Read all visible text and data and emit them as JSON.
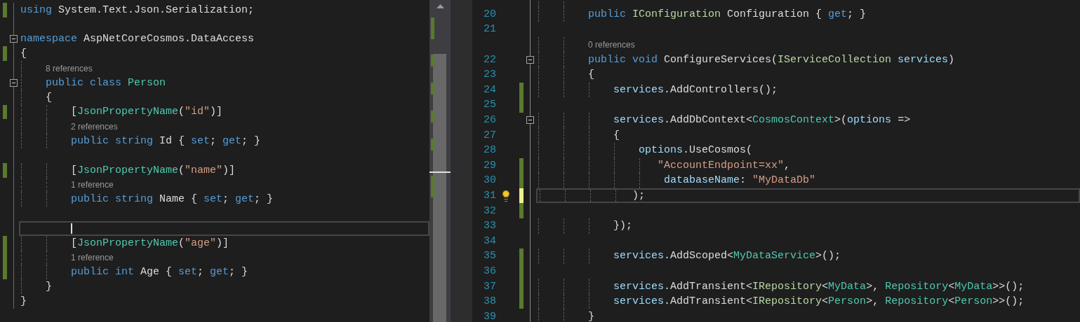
{
  "left_editor": {
    "lines": [
      {
        "kind": "code",
        "changed": true,
        "saved": true,
        "tokens": [
          {
            "text": "using",
            "kind": "keyword"
          },
          {
            "text": " System.Text.Json.Serialization;",
            "kind": "plain"
          }
        ]
      },
      {
        "kind": "blank"
      },
      {
        "kind": "code",
        "fold": true,
        "tokens": [
          {
            "text": "namespace",
            "kind": "keyword"
          },
          {
            "text": " AspNetCoreCosmos.DataAccess",
            "kind": "plain"
          }
        ]
      },
      {
        "kind": "code",
        "changed": true,
        "saved": true,
        "tokens": [
          {
            "text": "{",
            "kind": "plain"
          }
        ]
      },
      {
        "kind": "codelens",
        "text": "8 references"
      },
      {
        "kind": "code",
        "fold": true,
        "tokens": [
          {
            "text": "    public class",
            "kind": "keyword"
          },
          {
            "text": " Person",
            "kind": "type"
          }
        ]
      },
      {
        "kind": "code",
        "tokens": [
          {
            "text": "    {",
            "kind": "plain"
          }
        ]
      },
      {
        "kind": "code",
        "changed": true,
        "saved": true,
        "tokens": [
          {
            "text": "        [",
            "kind": "plain"
          },
          {
            "text": "JsonPropertyName",
            "kind": "type"
          },
          {
            "text": "(",
            "kind": "plain"
          },
          {
            "text": "\"id\"",
            "kind": "string"
          },
          {
            "text": ")]",
            "kind": "plain"
          }
        ]
      },
      {
        "kind": "codelens",
        "text": "2 references"
      },
      {
        "kind": "code",
        "tokens": [
          {
            "text": "        public string",
            "kind": "keyword"
          },
          {
            "text": " Id { ",
            "kind": "plain"
          },
          {
            "text": "set",
            "kind": "keyword"
          },
          {
            "text": "; ",
            "kind": "plain"
          },
          {
            "text": "get",
            "kind": "keyword"
          },
          {
            "text": "; }",
            "kind": "plain"
          }
        ]
      },
      {
        "kind": "blank"
      },
      {
        "kind": "code",
        "changed": true,
        "saved": true,
        "tokens": [
          {
            "text": "        [",
            "kind": "plain"
          },
          {
            "text": "JsonPropertyName",
            "kind": "type"
          },
          {
            "text": "(",
            "kind": "plain"
          },
          {
            "text": "\"name\"",
            "kind": "string"
          },
          {
            "text": ")]",
            "kind": "plain"
          }
        ]
      },
      {
        "kind": "codelens",
        "text": "1 reference"
      },
      {
        "kind": "code",
        "tokens": [
          {
            "text": "        public string",
            "kind": "keyword"
          },
          {
            "text": " Name { ",
            "kind": "plain"
          },
          {
            "text": "set",
            "kind": "keyword"
          },
          {
            "text": "; ",
            "kind": "plain"
          },
          {
            "text": "get",
            "kind": "keyword"
          },
          {
            "text": "; }",
            "kind": "plain"
          }
        ]
      },
      {
        "kind": "blank"
      },
      {
        "kind": "blank",
        "current": true
      },
      {
        "kind": "code",
        "changed": true,
        "saved": true,
        "tokens": [
          {
            "text": "        [",
            "kind": "plain"
          },
          {
            "text": "JsonPropertyName",
            "kind": "type"
          },
          {
            "text": "(",
            "kind": "plain"
          },
          {
            "text": "\"age\"",
            "kind": "string"
          },
          {
            "text": ")]",
            "kind": "plain"
          }
        ]
      },
      {
        "kind": "codelens",
        "changed": true,
        "saved": true,
        "text": "1 reference"
      },
      {
        "kind": "code",
        "changed": true,
        "saved": true,
        "tokens": [
          {
            "text": "        public int",
            "kind": "keyword"
          },
          {
            "text": " Age { ",
            "kind": "plain"
          },
          {
            "text": "set",
            "kind": "keyword"
          },
          {
            "text": "; ",
            "kind": "plain"
          },
          {
            "text": "get",
            "kind": "keyword"
          },
          {
            "text": "; }",
            "kind": "plain"
          }
        ]
      },
      {
        "kind": "code",
        "tokens": [
          {
            "text": "    }",
            "kind": "plain"
          }
        ]
      },
      {
        "kind": "code",
        "tokens": [
          {
            "text": "}",
            "kind": "plain"
          }
        ]
      }
    ]
  },
  "right_editor": {
    "lines": [
      {
        "kind": "codelens"
      },
      {
        "kind": "code",
        "number": "20",
        "tokens": [
          {
            "text": "        public",
            "kind": "keyword"
          },
          {
            "text": " IConfiguration",
            "kind": "interface"
          },
          {
            "text": " Configuration { ",
            "kind": "plain"
          },
          {
            "text": "get",
            "kind": "keyword"
          },
          {
            "text": "; }",
            "kind": "plain"
          }
        ]
      },
      {
        "kind": "blank",
        "number": "21"
      },
      {
        "kind": "codelens",
        "text": "0 references"
      },
      {
        "kind": "code",
        "number": "22",
        "fold": true,
        "tokens": [
          {
            "text": "        public void",
            "kind": "keyword"
          },
          {
            "text": " ConfigureServices(",
            "kind": "plain"
          },
          {
            "text": "IServiceCollection",
            "kind": "interface"
          },
          {
            "text": " services",
            "kind": "param"
          },
          {
            "text": ")",
            "kind": "plain"
          }
        ]
      },
      {
        "kind": "code",
        "number": "23",
        "tokens": [
          {
            "text": "        {",
            "kind": "plain"
          }
        ]
      },
      {
        "kind": "code",
        "number": "24",
        "changed": true,
        "saved": true,
        "tokens": [
          {
            "text": "            services",
            "kind": "param"
          },
          {
            "text": ".AddControllers();",
            "kind": "plain"
          }
        ]
      },
      {
        "kind": "blank",
        "number": "25",
        "changed": true,
        "saved": true
      },
      {
        "kind": "code",
        "number": "26",
        "fold": true,
        "tokens": [
          {
            "text": "            services",
            "kind": "param"
          },
          {
            "text": ".AddDbContext<",
            "kind": "plain"
          },
          {
            "text": "CosmosContext",
            "kind": "type"
          },
          {
            "text": ">(",
            "kind": "plain"
          },
          {
            "text": "options",
            "kind": "param"
          },
          {
            "text": " =>",
            "kind": "plain"
          }
        ]
      },
      {
        "kind": "code",
        "number": "27",
        "tokens": [
          {
            "text": "            {",
            "kind": "plain"
          }
        ]
      },
      {
        "kind": "code",
        "number": "28",
        "tokens": [
          {
            "text": "                options",
            "kind": "param"
          },
          {
            "text": ".UseCosmos(",
            "kind": "plain"
          }
        ]
      },
      {
        "kind": "code",
        "number": "29",
        "changed": true,
        "saved": true,
        "tokens": [
          {
            "text": "                   \"AccountEndpoint=xx\"",
            "kind": "string"
          },
          {
            "text": ",",
            "kind": "plain"
          }
        ]
      },
      {
        "kind": "code",
        "number": "30",
        "changed": true,
        "saved": true,
        "tokens": [
          {
            "text": "                    databaseName",
            "kind": "param"
          },
          {
            "text": ": ",
            "kind": "plain"
          },
          {
            "text": "\"MyDataDb\"",
            "kind": "string"
          }
        ]
      },
      {
        "kind": "code",
        "number": "31",
        "changed": true,
        "saved": false,
        "current": true,
        "lightbulb": true,
        "tokens": [
          {
            "text": "               );",
            "kind": "plain"
          }
        ]
      },
      {
        "kind": "blank",
        "number": "32",
        "changed": true,
        "saved": true
      },
      {
        "kind": "code",
        "number": "33",
        "tokens": [
          {
            "text": "            });",
            "kind": "plain"
          }
        ]
      },
      {
        "kind": "blank",
        "number": "34"
      },
      {
        "kind": "code",
        "number": "35",
        "changed": true,
        "saved": true,
        "tokens": [
          {
            "text": "            services",
            "kind": "param"
          },
          {
            "text": ".AddScoped<",
            "kind": "plain"
          },
          {
            "text": "MyDataService",
            "kind": "type"
          },
          {
            "text": ">();",
            "kind": "plain"
          }
        ]
      },
      {
        "kind": "blank",
        "number": "36",
        "changed": true,
        "saved": true
      },
      {
        "kind": "code",
        "number": "37",
        "changed": true,
        "saved": true,
        "tokens": [
          {
            "text": "            services",
            "kind": "param"
          },
          {
            "text": ".AddTransient<",
            "kind": "plain"
          },
          {
            "text": "IRepository",
            "kind": "interface"
          },
          {
            "text": "<",
            "kind": "plain"
          },
          {
            "text": "MyData",
            "kind": "type"
          },
          {
            "text": ">, ",
            "kind": "plain"
          },
          {
            "text": "Repository",
            "kind": "type"
          },
          {
            "text": "<",
            "kind": "plain"
          },
          {
            "text": "MyData",
            "kind": "type"
          },
          {
            "text": ">>();",
            "kind": "plain"
          }
        ]
      },
      {
        "kind": "code",
        "number": "38",
        "changed": true,
        "saved": true,
        "tokens": [
          {
            "text": "            services",
            "kind": "param"
          },
          {
            "text": ".AddTransient<",
            "kind": "plain"
          },
          {
            "text": "IRepository",
            "kind": "interface"
          },
          {
            "text": "<",
            "kind": "plain"
          },
          {
            "text": "Person",
            "kind": "type"
          },
          {
            "text": ">, ",
            "kind": "plain"
          },
          {
            "text": "Repository",
            "kind": "type"
          },
          {
            "text": "<",
            "kind": "plain"
          },
          {
            "text": "Person",
            "kind": "type"
          },
          {
            "text": ">>();",
            "kind": "plain"
          }
        ]
      },
      {
        "kind": "code",
        "number": "39",
        "tokens": [
          {
            "text": "        }",
            "kind": "plain"
          }
        ]
      }
    ]
  }
}
